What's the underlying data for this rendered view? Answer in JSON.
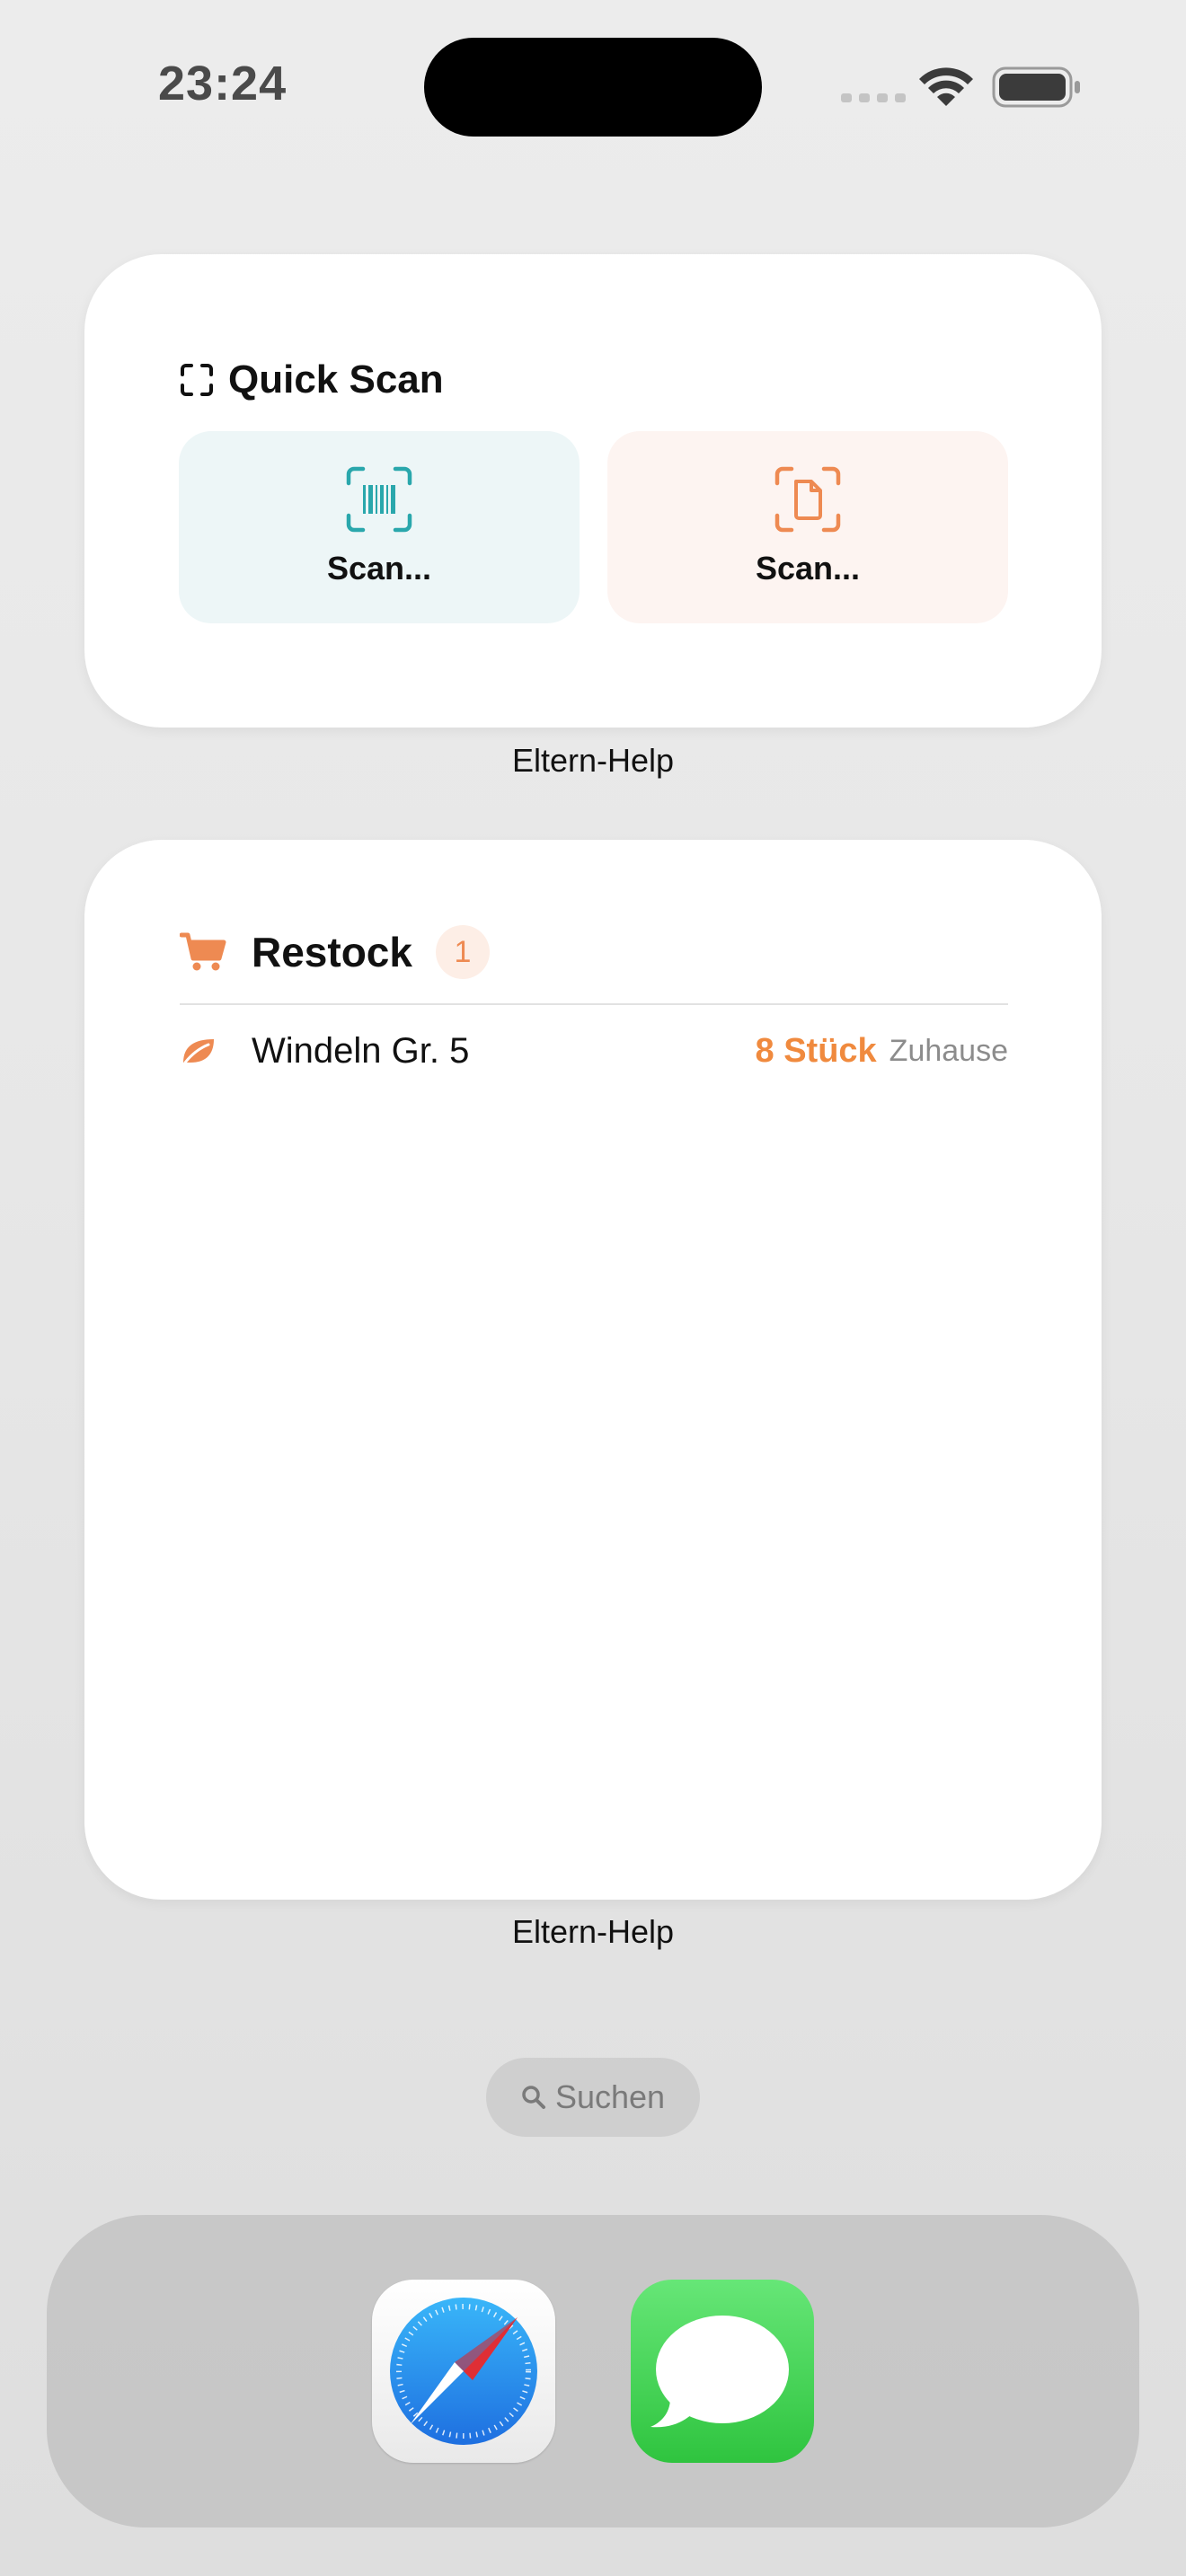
{
  "status_bar": {
    "time": "23:24"
  },
  "widgets": {
    "quick_scan": {
      "title": "Quick Scan",
      "tiles": [
        {
          "label": "Scan...",
          "icon": "barcode-scan-icon",
          "color": "#2aa7ac"
        },
        {
          "label": "Scan...",
          "icon": "document-scan-icon",
          "color": "#ee8a52"
        }
      ],
      "caption": "Eltern-Help"
    },
    "restock": {
      "title": "Restock",
      "count": "1",
      "icon": "cart-icon",
      "items": [
        {
          "name": "Windeln Gr. 5",
          "quantity": "8 Stück",
          "location": "Zuhause",
          "icon": "leaf-icon"
        }
      ],
      "caption": "Eltern-Help"
    }
  },
  "search": {
    "label": "Suchen"
  },
  "dock": {
    "apps": [
      {
        "name": "Safari",
        "icon": "safari-icon"
      },
      {
        "name": "Messages",
        "icon": "messages-icon"
      }
    ]
  },
  "colors": {
    "accent_orange": "#ee8a52",
    "accent_teal": "#2aa7ac",
    "quantity_orange": "#f08a3e"
  }
}
